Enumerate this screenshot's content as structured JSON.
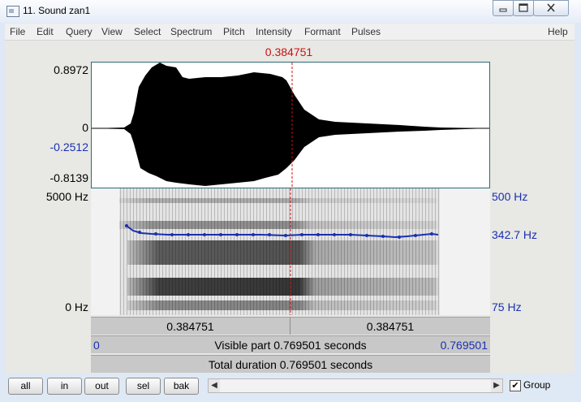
{
  "window": {
    "title": "11. Sound zan1",
    "minimize_icon": "minimize-icon",
    "maximize_icon": "maximize-icon",
    "close_icon": "close-icon"
  },
  "menu": [
    "File",
    "Edit",
    "Query",
    "View",
    "Select",
    "Spectrum",
    "Pitch",
    "Intensity",
    "Formant",
    "Pulses",
    "Help"
  ],
  "cursor": {
    "time": "0.384751",
    "color": "#cc1111"
  },
  "waveform": {
    "y_max": "0.8972",
    "y_zero": "0",
    "y_cursor": "-0.2512",
    "y_min": "-0.8139"
  },
  "spectrogram": {
    "freq_max": "5000 Hz",
    "freq_min": "0 Hz",
    "pitch_max": "500 Hz",
    "pitch_value": "342.7 Hz",
    "pitch_min": "75 Hz",
    "pitch_color": "#1a2fb0"
  },
  "time_bars": {
    "left_segment": "0.384751",
    "right_segment": "0.384751",
    "visible_start": "0",
    "visible_text": "Visible part 0.769501 seconds",
    "visible_end": "0.769501",
    "total_text": "Total duration 0.769501 seconds"
  },
  "buttons": [
    "all",
    "in",
    "out",
    "sel",
    "bak"
  ],
  "group": {
    "label": "Group",
    "checked": true,
    "check_glyph": "✔"
  }
}
